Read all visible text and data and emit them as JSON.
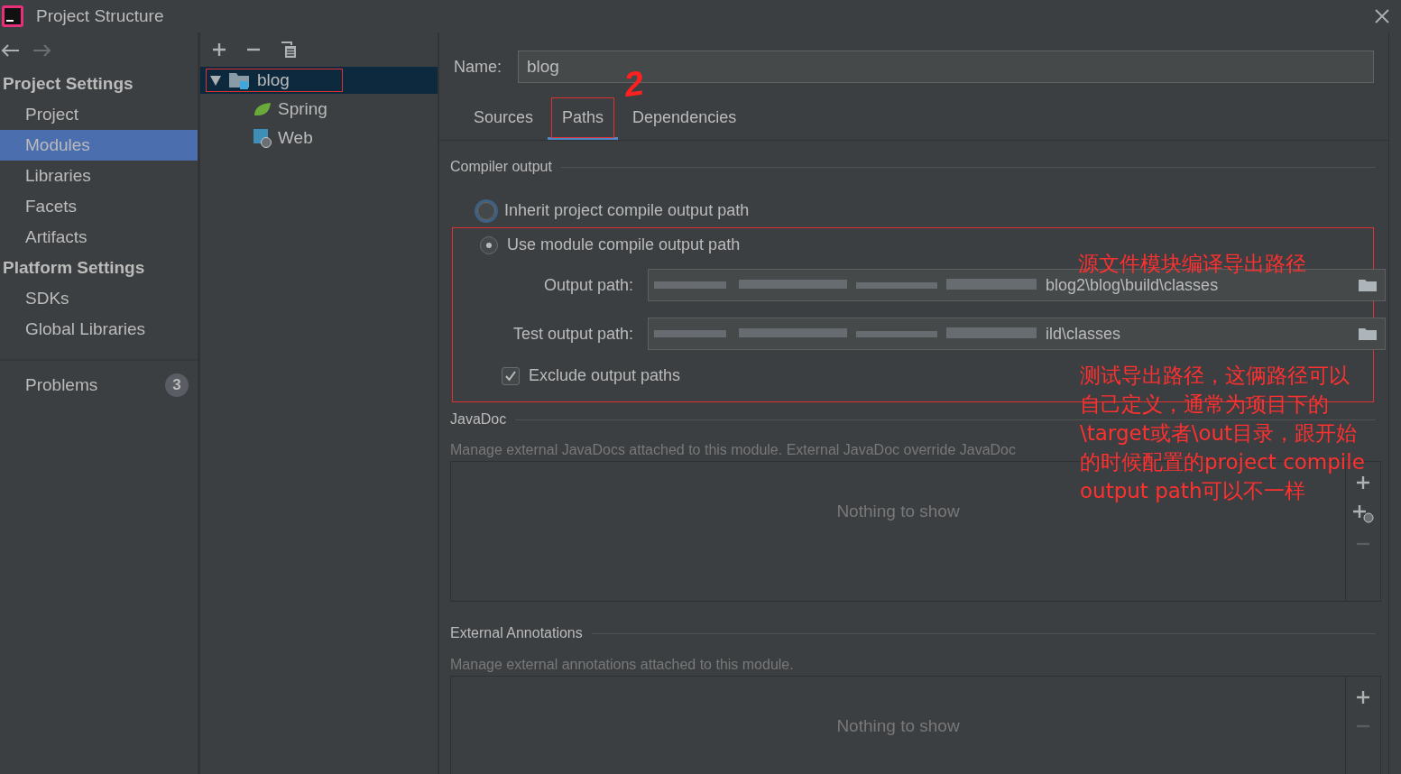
{
  "window": {
    "title": "Project Structure"
  },
  "sidebar": {
    "groups": [
      {
        "title": "Project Settings",
        "items": [
          {
            "label": "Project",
            "selected": false
          },
          {
            "label": "Modules",
            "selected": true
          },
          {
            "label": "Libraries",
            "selected": false
          },
          {
            "label": "Facets",
            "selected": false
          },
          {
            "label": "Artifacts",
            "selected": false
          }
        ]
      },
      {
        "title": "Platform Settings",
        "items": [
          {
            "label": "SDKs",
            "selected": false
          },
          {
            "label": "Global Libraries",
            "selected": false
          }
        ]
      }
    ],
    "problems": {
      "label": "Problems",
      "count": "3"
    }
  },
  "tree": {
    "items": [
      {
        "label": "blog",
        "kind": "module",
        "selected": true,
        "expanded": true,
        "children": [
          {
            "label": "Spring",
            "kind": "spring",
            "selected": false
          },
          {
            "label": "Web",
            "kind": "web",
            "selected": false
          }
        ]
      }
    ]
  },
  "module": {
    "name_label": "Name:",
    "name": "blog",
    "tabs": [
      {
        "label": "Sources",
        "selected": false
      },
      {
        "label": "Paths",
        "selected": true
      },
      {
        "label": "Dependencies",
        "selected": false
      }
    ]
  },
  "compiler_output": {
    "title": "Compiler output",
    "options": [
      {
        "label": "Inherit project compile output path",
        "selected": false,
        "focused": true
      },
      {
        "label": "Use module compile output path",
        "selected": true,
        "focused": false
      }
    ],
    "output_path": {
      "label": "Output path:",
      "value": "blog2\\blog\\build\\classes"
    },
    "test_output_path": {
      "label": "Test output path:",
      "value": "ild\\classes"
    },
    "exclude": {
      "label": "Exclude output paths",
      "checked": true
    }
  },
  "javadoc": {
    "title": "JavaDoc",
    "description": "Manage external JavaDocs attached to this module. External JavaDoc override JavaDoc",
    "empty_text": "Nothing to show"
  },
  "external_annotations": {
    "title": "External Annotations",
    "description": "Manage external annotations attached to this module.",
    "empty_text": "Nothing to show"
  },
  "annotations": [
    {
      "kind": "mark",
      "text": "2"
    },
    {
      "kind": "note",
      "lines": [
        "源文件模块编译导出路径"
      ]
    },
    {
      "kind": "note",
      "lines": [
        "测试导出路径，这俩路径可以",
        "自己定义，通常为项目下的",
        "\\target或者\\out目录，跟开始",
        "的时候配置的project compile",
        "output path可以不一样"
      ]
    }
  ]
}
